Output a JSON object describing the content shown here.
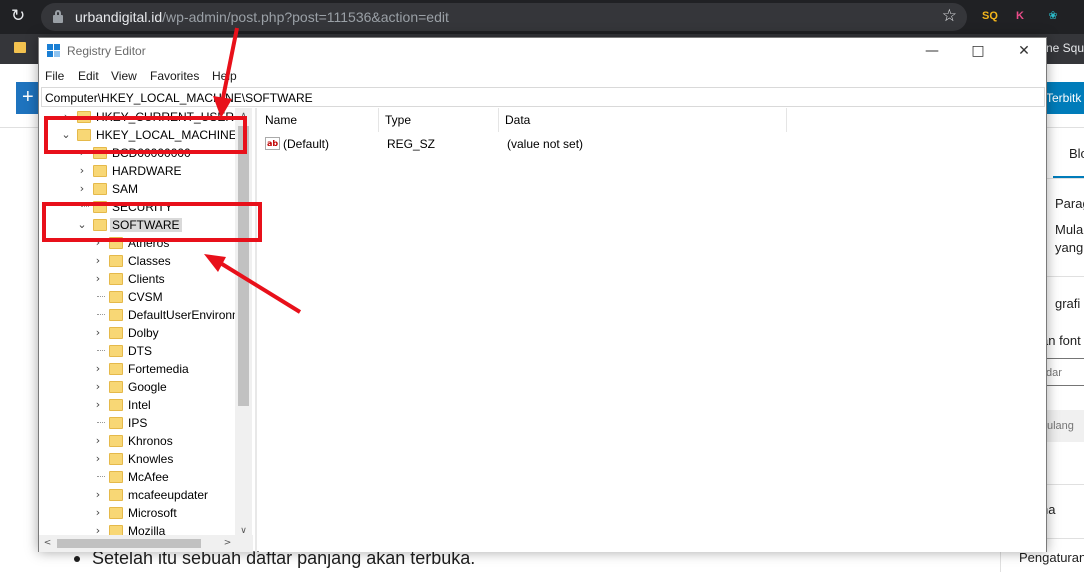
{
  "browser": {
    "url_host": "urbandigital.id",
    "url_path": "/wp-admin/post.php?post=111536&action=edit",
    "extensions": [
      "SQ",
      "K",
      "❀"
    ],
    "bookmark_right_text": "ne Squ"
  },
  "wp": {
    "publish_label": "Terbitk",
    "sidebar_tab": "Blo",
    "sidebar_block_name": "Parag",
    "sidebar_desc_1": "Mula",
    "sidebar_desc_2": "yang",
    "typography_label": "grafi",
    "font_size_label": "an font",
    "select_value": "dar",
    "reset_label": "ulang",
    "color_label": "na",
    "settings_label": "Pengaturan",
    "bullet_text": "Setelah itu sebuah daftar panjang akan terbuka."
  },
  "regedit": {
    "title": "Registry Editor",
    "menu": [
      "File",
      "Edit",
      "View",
      "Favorites",
      "Help"
    ],
    "address": "Computer\\HKEY_LOCAL_MACHINE\\SOFTWARE",
    "tree": {
      "hkcu": "HKEY_CURRENT_USER",
      "hklm": "HKEY_LOCAL_MACHINE",
      "hklm_children": [
        "BCD00000000",
        "HARDWARE",
        "SAM",
        "SECURITY",
        "SOFTWARE"
      ],
      "software_children": [
        "Atheros",
        "Classes",
        "Clients",
        "CVSM",
        "DefaultUserEnvironm",
        "Dolby",
        "DTS",
        "Fortemedia",
        "Google",
        "Intel",
        "IPS",
        "Khronos",
        "Knowles",
        "McAfee",
        "mcafeeupdater",
        "Microsoft",
        "Mozilla"
      ]
    },
    "columns": [
      "Name",
      "Type",
      "Data"
    ],
    "values": [
      {
        "name": "(Default)",
        "type": "REG_SZ",
        "data": "(value not set)"
      }
    ]
  },
  "colors": {
    "annotation": "#e8101a",
    "folder": "#f8d775",
    "wp_blue": "#007cba"
  }
}
